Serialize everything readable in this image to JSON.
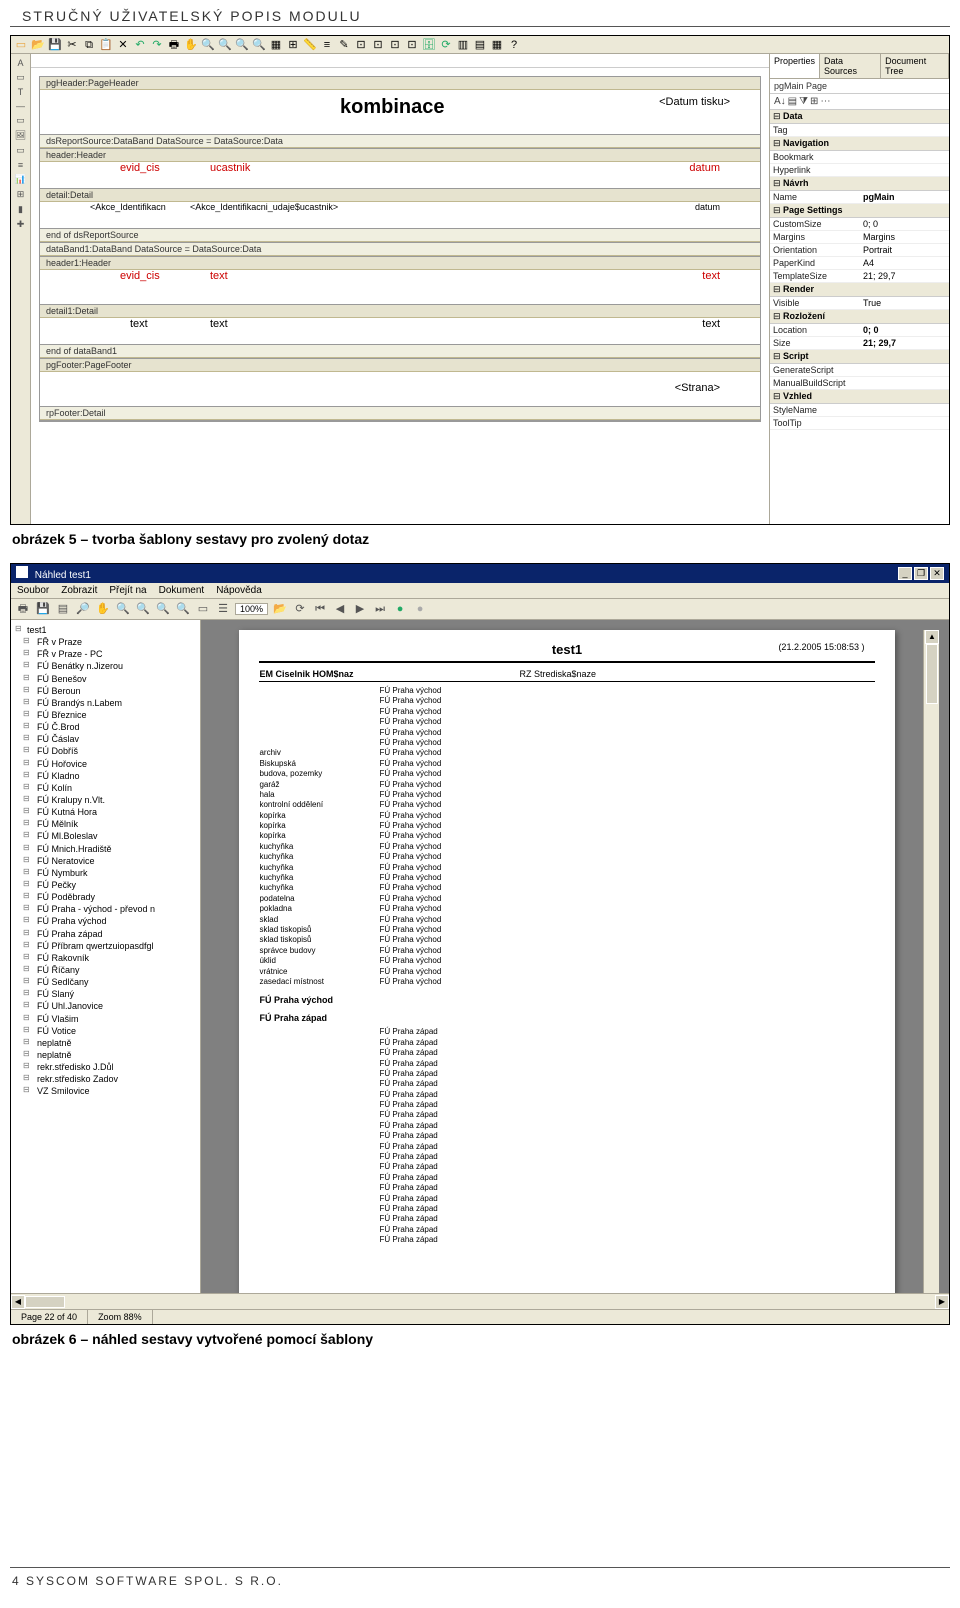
{
  "doc": {
    "header": "STRUČNÝ UŽIVATELSKÝ POPIS MODULU",
    "caption1": "obrázek 5 – tvorba šablony sestavy pro zvolený dotaz",
    "caption2": "obrázek 6 – náhled sestavy vytvořené pomocí šablony",
    "footer": "4 SYSCOM SOFTWARE SPOL. S R.O."
  },
  "designer": {
    "bands": {
      "pageHeader": "pgHeader:PageHeader",
      "titleText": "kombinace",
      "datumTisku": "<Datum tisku>",
      "dsReport": "dsReportSource:DataBand DataSource = DataSource:Data",
      "header": "header:Header",
      "header_cols": {
        "c1": "evid_cis",
        "c2": "ucastnik",
        "c3": "datum"
      },
      "detail": "detail:Detail",
      "detail_field1": "<Akce_Identifikacn",
      "detail_field2": "<Akce_Identifikacni_udaje$ucastnik>",
      "detail_field3": "datum",
      "endDs": "end of dsReportSource",
      "dataBand1": "dataBand1:DataBand DataSource = DataSource:Data",
      "header1": "header1:Header",
      "header1_cols": {
        "c1": "evid_cis",
        "c2": "text",
        "c3": "text"
      },
      "detail1": "detail1:Detail",
      "detail1_cols": {
        "c1": "text",
        "c2": "text",
        "c3": "text"
      },
      "endDb1": "end of dataBand1",
      "pgFooter": "pgFooter:PageFooter",
      "strana": "<Strana>",
      "rpFooter": "rpFooter:Detail"
    },
    "prop_tabs": [
      "Properties",
      "Data Sources",
      "Document Tree"
    ],
    "prop_head": "pgMain Page",
    "groups": [
      {
        "name": "Data",
        "rows": [
          [
            "Tag",
            ""
          ]
        ]
      },
      {
        "name": "Navigation",
        "rows": [
          [
            "Bookmark",
            ""
          ],
          [
            "Hyperlink",
            ""
          ]
        ]
      },
      {
        "name": "Návrh",
        "rows": [
          [
            "Name",
            "pgMain"
          ]
        ]
      },
      {
        "name": "Page Settings",
        "rows": [
          [
            "CustomSize",
            "0; 0"
          ],
          [
            "Margins",
            "Margins"
          ],
          [
            "Orientation",
            "Portrait"
          ],
          [
            "PaperKind",
            "A4"
          ],
          [
            "TemplateSize",
            "21; 29,7"
          ]
        ]
      },
      {
        "name": "Render",
        "rows": [
          [
            "Visible",
            "True"
          ]
        ]
      },
      {
        "name": "Rozložení",
        "rows": [
          [
            "Location",
            "0; 0"
          ],
          [
            "Size",
            "21; 29,7"
          ]
        ]
      },
      {
        "name": "Script",
        "rows": [
          [
            "GenerateScript",
            ""
          ],
          [
            "ManualBuildScript",
            ""
          ]
        ]
      },
      {
        "name": "Vzhled",
        "rows": [
          [
            "StyleName",
            ""
          ],
          [
            "ToolTip",
            ""
          ]
        ]
      }
    ]
  },
  "preview": {
    "title": "Náhled test1",
    "menus": [
      "Soubor",
      "Zobrazit",
      "Přejít na",
      "Dokument",
      "Nápověda"
    ],
    "status": {
      "page": "Page 22 of 40",
      "zoom": "Zoom 88%"
    },
    "toolbar_zoom": "100%",
    "tree_root": "test1",
    "tree_items": [
      "FŘ v Praze",
      "FŘ v Praze - PC",
      "FÚ Benátky n.Jizerou",
      "FÚ Benešov",
      "FÚ Beroun",
      "FÚ Brandýs n.Labem",
      "FÚ Březnice",
      "FÚ Č.Brod",
      "FÚ Čáslav",
      "FÚ Dobříš",
      "FÚ Hořovice",
      "FÚ Kladno",
      "FÚ Kolín",
      "FÚ Kralupy n.Vlt.",
      "FÚ Kutná Hora",
      "FÚ Mělník",
      "FÚ Ml.Boleslav",
      "FÚ Mnich.Hradiště",
      "FÚ Neratovice",
      "FÚ Nymburk",
      "FÚ Pečky",
      "FÚ Poděbrady",
      "FÚ Praha - východ - převod n",
      "FÚ Praha východ",
      "FÚ Praha západ",
      "FÚ Příbram qwertzuiopasdfgl",
      "FÚ Rakovník",
      "FÚ Říčany",
      "FÚ Sedlčany",
      "FÚ Slaný",
      "FÚ Uhl.Janovice",
      "FÚ Vlašim",
      "FÚ Votice",
      "neplatně",
      "neplatně",
      "rekr.středisko J.Důl",
      "rekr.středisko Zadov",
      "VZ Smilovice"
    ],
    "report": {
      "title": "test1",
      "datetime": "(21.2.2005 15:08:53 )",
      "col_headers": {
        "c1": "EM  Ciselnik HOM$naz",
        "c2": "RZ  Strediska$naze"
      },
      "vychod_label": "FÚ Praha východ",
      "zapad_label": "FÚ Praha západ",
      "rows_vychod_a": [
        "",
        "",
        "",
        "",
        "",
        "",
        "archiv",
        "Biskupská",
        "budova, pozemky",
        "garáž",
        "hala",
        "kontrolní oddělení",
        "kopírka",
        "kopírka",
        "kopírka",
        "kuchyňka",
        "kuchyňka",
        "kuchyňka",
        "kuchyňka",
        "kuchyňka",
        "podatelna",
        "pokladna",
        "sklad",
        "sklad tiskopisů",
        "sklad tiskopisů",
        "správce budovy",
        "úklid",
        "vrátnice",
        "zasedací místnost"
      ],
      "rows_vychod_count": 29,
      "rows_zapad_count": 21
    }
  }
}
